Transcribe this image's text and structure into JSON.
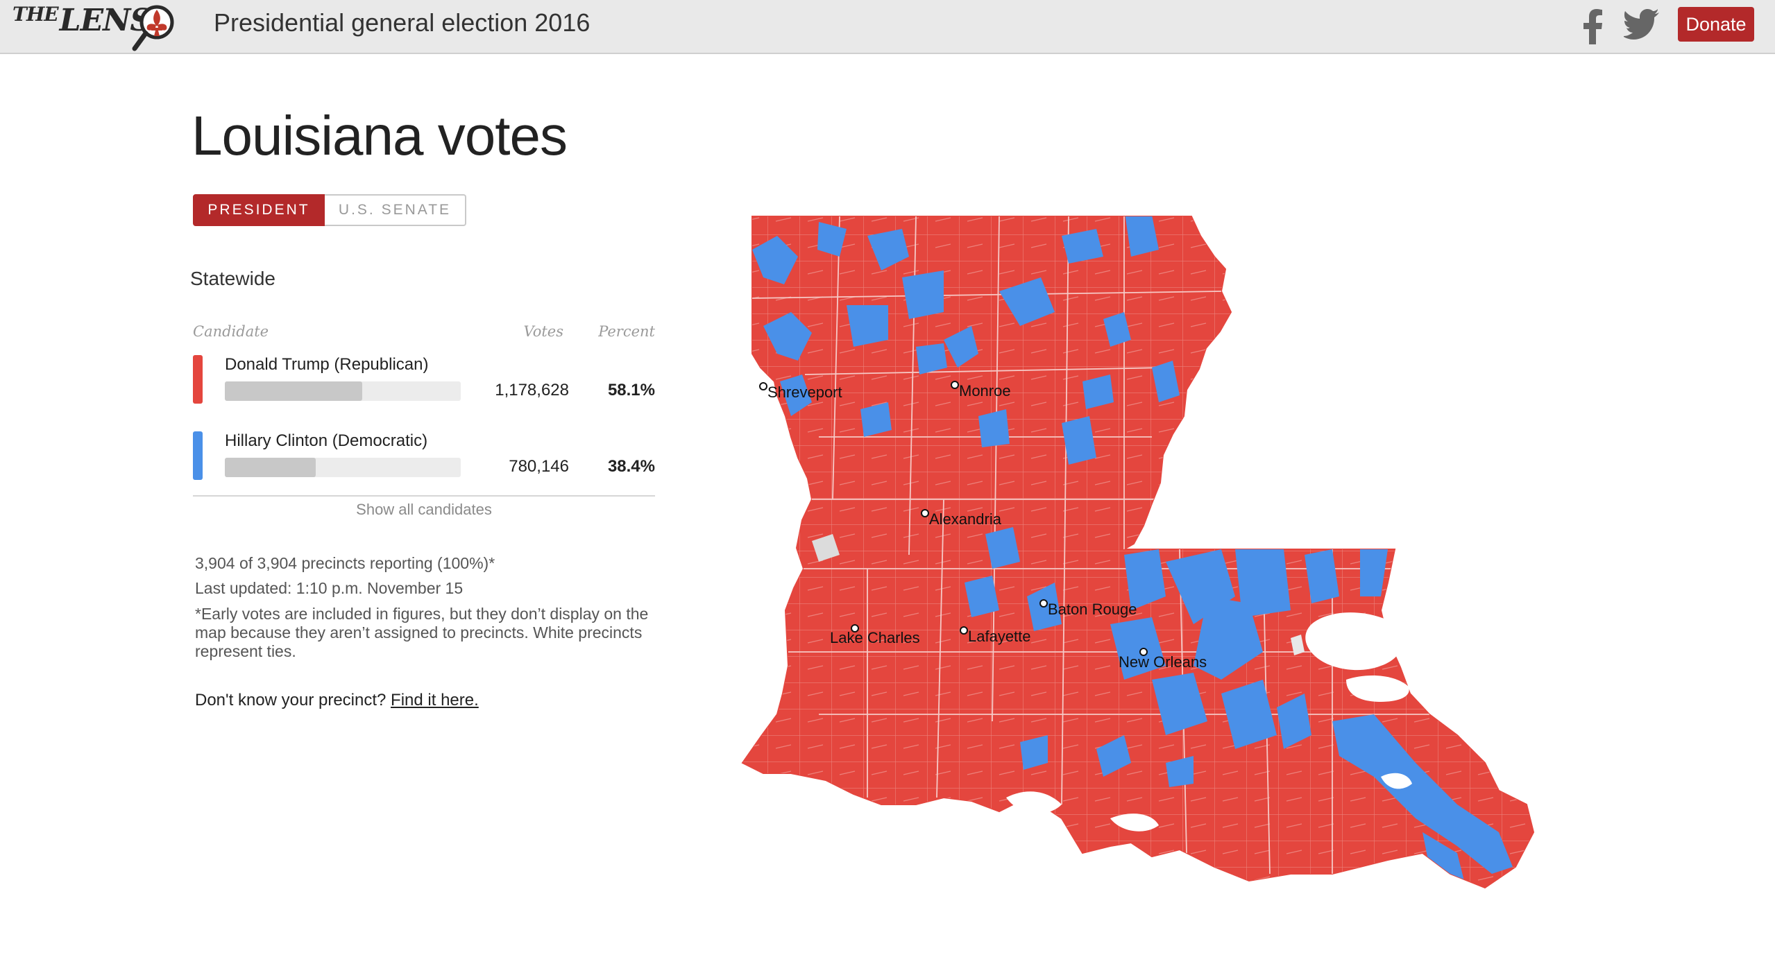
{
  "header": {
    "logo_text": "THE LENS",
    "title": "Presidential general election 2016",
    "donate_label": "Donate"
  },
  "page": {
    "title": "Louisiana votes"
  },
  "tabs": [
    {
      "label": "PRESIDENT",
      "active": true
    },
    {
      "label": "U.S. SENATE",
      "active": false
    }
  ],
  "results": {
    "section_title": "Statewide",
    "columns": {
      "candidate": "Candidate",
      "votes": "Votes",
      "percent": "Percent"
    },
    "candidates": [
      {
        "name": "Donald Trump (Republican)",
        "votes": "1,178,628",
        "percent": "58.1%",
        "share": 0.581,
        "color": "#e4463e"
      },
      {
        "name": "Hillary Clinton (Democratic)",
        "votes": "780,146",
        "percent": "38.4%",
        "share": 0.384,
        "color": "#4a90e8"
      }
    ],
    "show_all_label": "Show all candidates"
  },
  "info": {
    "precincts": "3,904 of 3,904 precincts reporting (100%)*",
    "updated": "Last updated: 1:10 p.m. November 15",
    "note": "*Early votes are included in figures, but they don’t display on the map because they aren’t assigned to precincts. White precincts represent ties.",
    "find_prefix": "Don't know your precinct? ",
    "find_link": "Find it here."
  },
  "map": {
    "colors": {
      "republican": "#e4463e",
      "democratic": "#4a90e8",
      "tie": "#ffffff",
      "water": "#ffffff"
    },
    "cities": [
      "Shreveport",
      "Monroe",
      "Alexandria",
      "Baton Rouge",
      "Lake Charles",
      "Lafayette",
      "New Orleans"
    ]
  }
}
